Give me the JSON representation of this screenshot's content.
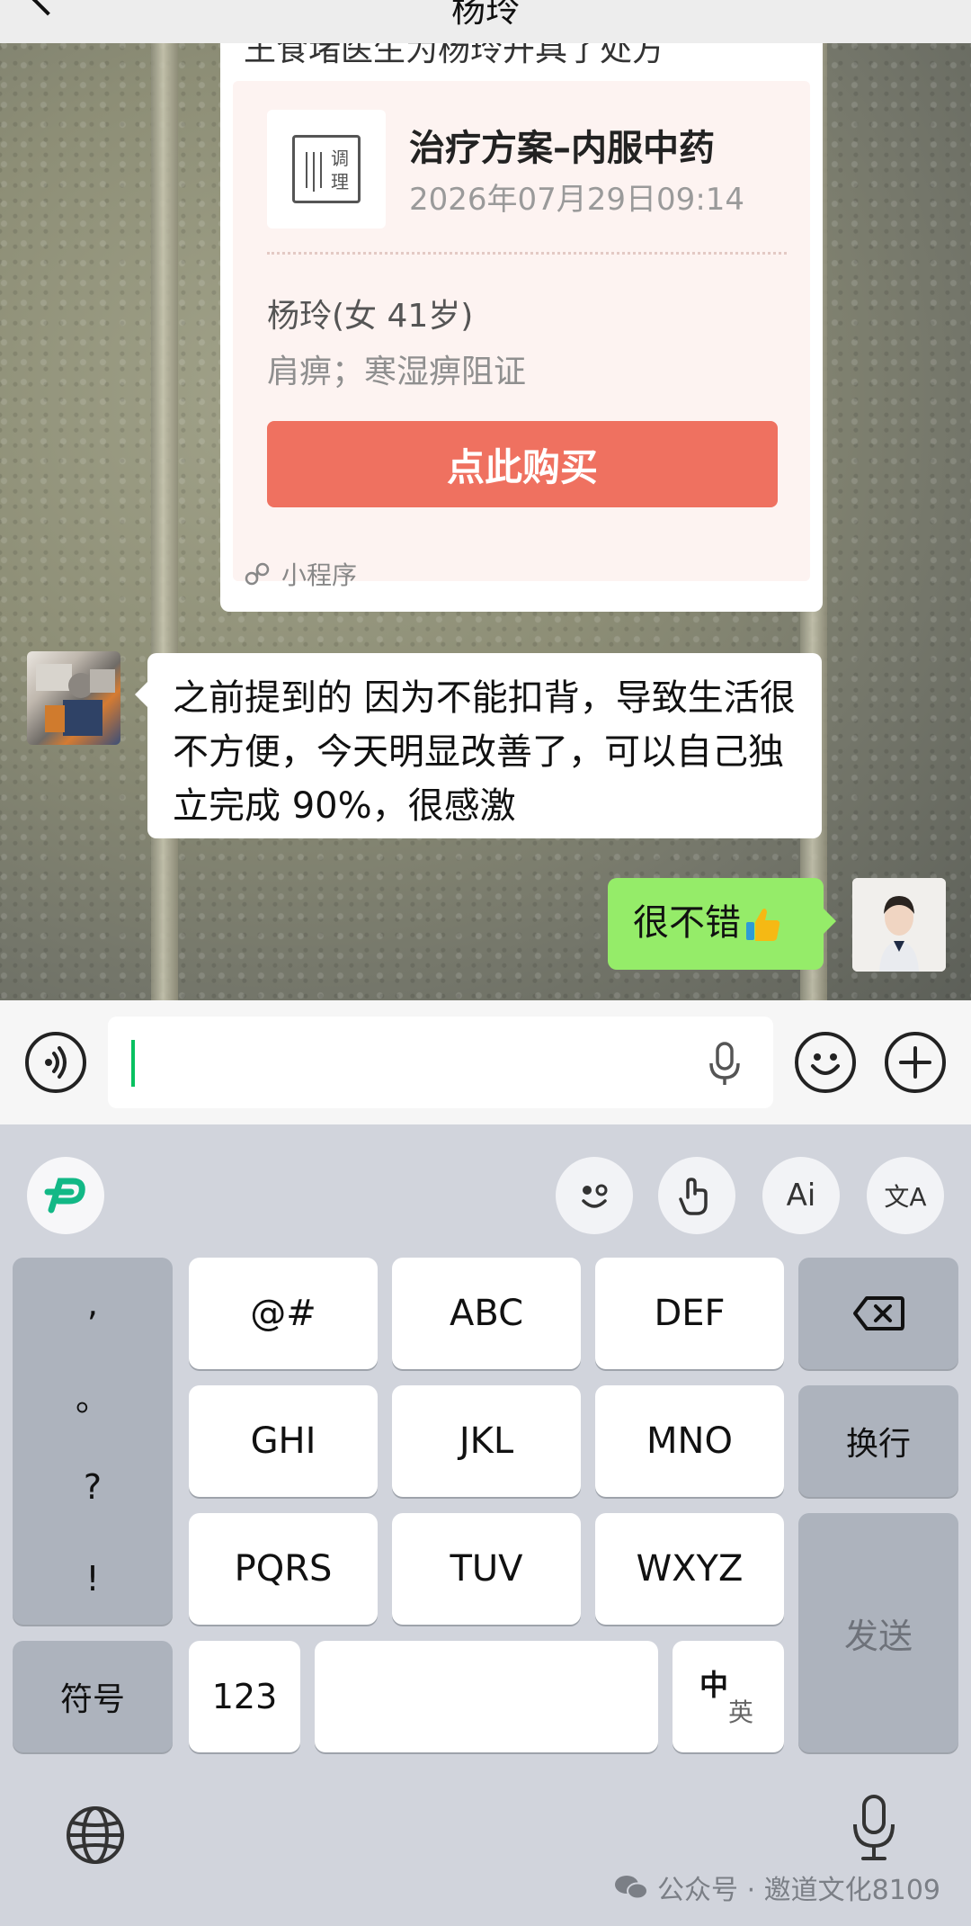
{
  "nav": {
    "title": "杨玲"
  },
  "card": {
    "clipped_text": "王食堵医生为杨玲开具了处方",
    "logo_text": "调理",
    "title": "治疗方案–内服中药",
    "time": "2026年07月29日09:14",
    "patient": "杨玲(女 41岁)",
    "diagnosis": "肩痹；寒湿痹阻证",
    "buy_label": "点此购买",
    "footer": "小程序"
  },
  "messages": {
    "incoming": "之前提到的 因为不能扣背，导致生活很不方便，今天明显改善了，可以自己独立完成 90%，很感激",
    "outgoing": "很不错"
  },
  "input": {
    "value": ""
  },
  "keyboard": {
    "punct": [
      ",",
      "。",
      "?",
      "!"
    ],
    "symbol": "符号",
    "keys": [
      "@#",
      "ABC",
      "DEF",
      "GHI",
      "JKL",
      "MNO",
      "PQRS",
      "TUV",
      "WXYZ"
    ],
    "num": "123",
    "lang_zh": "中",
    "lang_en": "英",
    "newline": "换行",
    "send": "发送",
    "tools": [
      "emoji-face-icon",
      "gesture-hand-icon",
      "ai-icon",
      "translate-icon"
    ],
    "tool_ai": "Ai",
    "tool_translate": "文A"
  },
  "watermark": "公众号 · 邀道文化8109",
  "colors": {
    "bubble_out": "#95ec69",
    "buy_button": "#ef7160",
    "cursor": "#07c160",
    "keyboard_bg": "#d1d4dc"
  }
}
